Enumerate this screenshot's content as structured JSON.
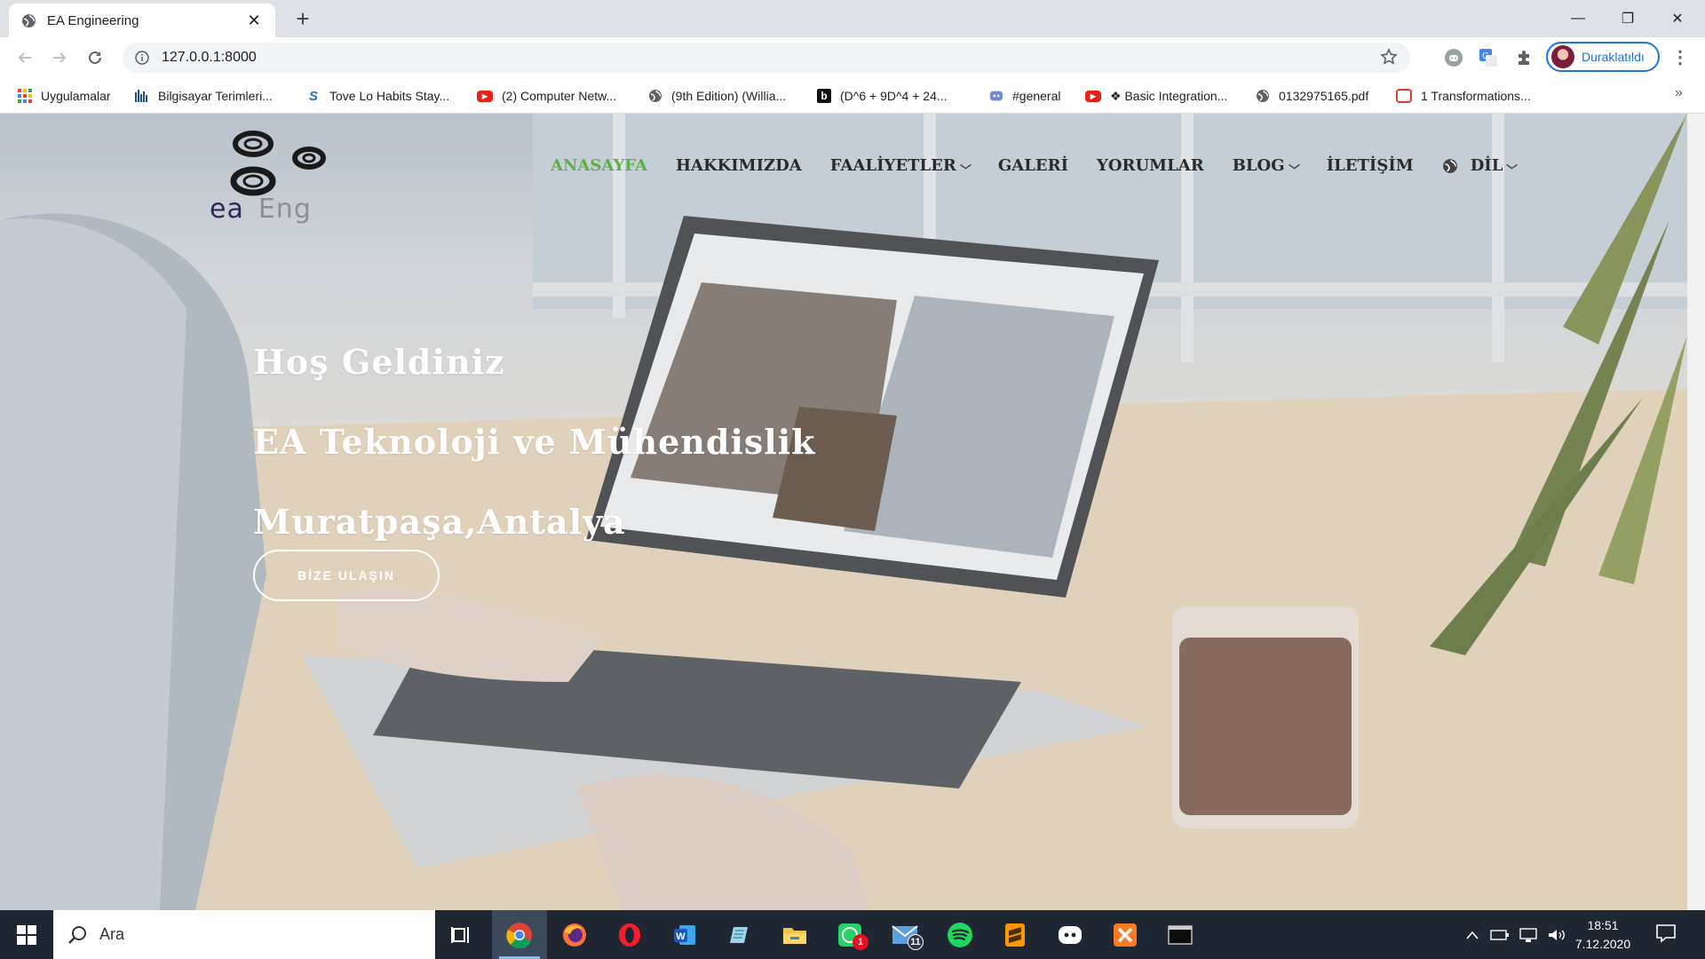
{
  "browser": {
    "tab": {
      "title": "EA Engineering",
      "close": "✕"
    },
    "new_tab": "+",
    "window_controls": {
      "minimize": "—",
      "restore": "❐",
      "close": "✕"
    },
    "url": "127.0.0.1:8000",
    "profile_name": "Duraklatıldı",
    "bookmarks": [
      {
        "label": "Uygulamalar",
        "icon": "apps-grid-icon"
      },
      {
        "label": "Bilgisayar Terimleri...",
        "icon": "bars-icon"
      },
      {
        "label": "Tove Lo Habits Stay...",
        "icon": "s-logo-icon"
      },
      {
        "label": "(2) Computer Netw...",
        "icon": "youtube-icon"
      },
      {
        "label": "(9th Edition) (Willia...",
        "icon": "globe-icon"
      },
      {
        "label": "(D^6 + 9D^4 + 24...",
        "icon": "b-logo-icon"
      },
      {
        "label": "#general",
        "icon": "discord-icon"
      },
      {
        "label": "❖ Basic Integration...",
        "icon": "youtube-icon"
      },
      {
        "label": "0132975165.pdf",
        "icon": "globe-icon"
      },
      {
        "label": "1 Transformations...",
        "icon": "red-square-icon"
      }
    ],
    "bookmarks_more": "»"
  },
  "site": {
    "logo": {
      "part1": "ea",
      "part2": "Eng"
    },
    "nav": [
      {
        "label": "ANASAYFA",
        "active": true,
        "dropdown": false
      },
      {
        "label": "HAKKIMIZDA",
        "active": false,
        "dropdown": false
      },
      {
        "label": "FAALİYETLER",
        "active": false,
        "dropdown": true
      },
      {
        "label": "GALERİ",
        "active": false,
        "dropdown": false
      },
      {
        "label": "YORUMLAR",
        "active": false,
        "dropdown": false
      },
      {
        "label": "BLOG",
        "active": false,
        "dropdown": true
      },
      {
        "label": "İLETİŞİM",
        "active": false,
        "dropdown": false
      }
    ],
    "language": {
      "label": "DİL",
      "icon": "globe-icon"
    },
    "chevron": "⌵",
    "hero": {
      "line1": "Hoş Geldiniz",
      "line2": "EA Teknoloji ve Mühendislik",
      "line3": "Muratpaşa,Antalya",
      "cta": "BİZE ULAŞIN"
    },
    "colors": {
      "active_nav": "#5fb048",
      "nav": "#2b2b2b",
      "hero_text": "#ffffff"
    }
  },
  "taskbar": {
    "search_placeholder": "Ara",
    "apps": [
      {
        "name": "task-view-icon"
      },
      {
        "name": "chrome-icon",
        "active": true
      },
      {
        "name": "firefox-icon"
      },
      {
        "name": "opera-icon"
      },
      {
        "name": "word-icon"
      },
      {
        "name": "notepad-icon"
      },
      {
        "name": "file-explorer-icon"
      },
      {
        "name": "whatsapp-icon",
        "badge": "1"
      },
      {
        "name": "mail-icon",
        "badge": "11"
      },
      {
        "name": "spotify-icon"
      },
      {
        "name": "sublime-icon"
      },
      {
        "name": "discord-icon"
      },
      {
        "name": "xampp-icon"
      },
      {
        "name": "terminal-icon"
      }
    ],
    "time": "18:51",
    "date": "7.12.2020"
  }
}
